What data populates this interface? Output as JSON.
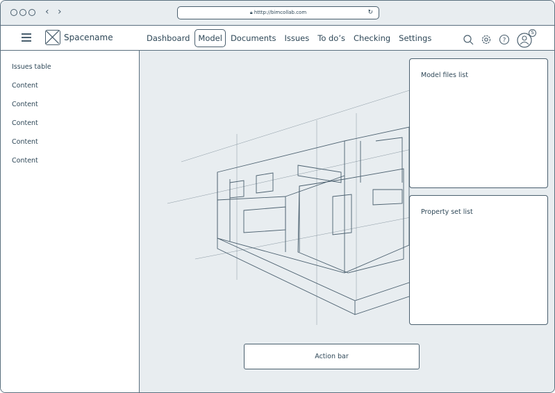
{
  "browser": {
    "url": "htttp://bimcollab.com"
  },
  "header": {
    "brand": "Spacename",
    "nav": [
      "Dashboard",
      "Model",
      "Documents",
      "Issues",
      "To do’s",
      "Checking",
      "Settings"
    ],
    "active": "Model",
    "avatar_badge": "S"
  },
  "sidebar": {
    "items": [
      "Issues table",
      "Content",
      "Content",
      "Content",
      "Content",
      "Content"
    ]
  },
  "main": {
    "model_files_title": "Model files list",
    "property_set_title": "Property set list",
    "action_bar": "Action bar"
  }
}
